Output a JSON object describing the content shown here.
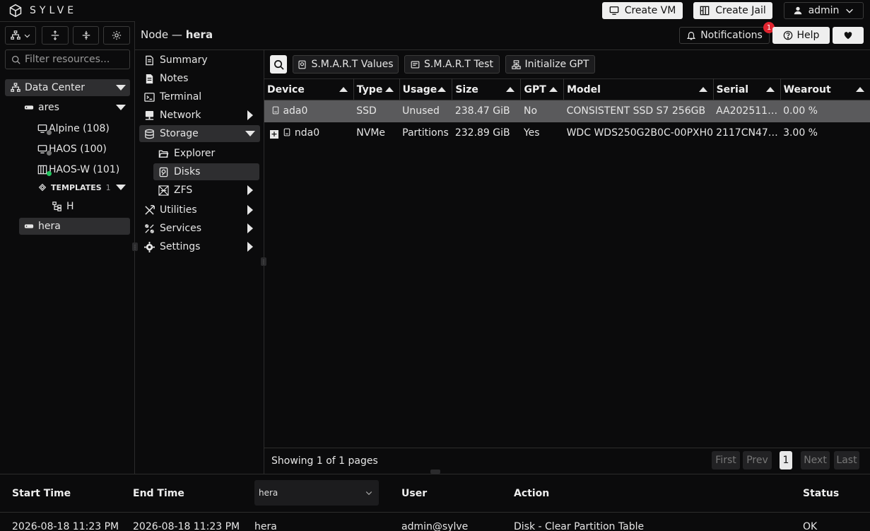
{
  "app": {
    "brand": "SYLVE"
  },
  "topbar": {
    "create_vm": "Create VM",
    "create_jail": "Create Jail",
    "user": "admin"
  },
  "sidebar": {
    "filter_placeholder": "Filter resources...",
    "tree": {
      "datacenter": "Data Center",
      "node_ares": "ares",
      "vm_alpine": "Alpine (108)",
      "vm_haos": "HAOS (100)",
      "jail_haosw": "HAOS-W (101)",
      "templates": "TEMPLATES",
      "templates_count": "1",
      "template_h": "H",
      "node_hera": "hera"
    },
    "status_colors": {
      "stopped": "#777777",
      "running": "#22c55e"
    }
  },
  "header": {
    "prefix": "Node —",
    "node": "hera",
    "notifications": "Notifications",
    "notif_count": "1",
    "help": "Help"
  },
  "nav": {
    "summary": "Summary",
    "notes": "Notes",
    "terminal": "Terminal",
    "network": "Network",
    "storage": "Storage",
    "explorer": "Explorer",
    "disks": "Disks",
    "zfs": "ZFS",
    "utilities": "Utilities",
    "services": "Services",
    "settings": "Settings"
  },
  "toolbar": {
    "smart_values": "S.M.A.R.T Values",
    "smart_test": "S.M.A.R.T Test",
    "init_gpt": "Initialize GPT"
  },
  "table": {
    "columns": [
      "Device",
      "Type",
      "Usage",
      "Size",
      "GPT",
      "Model",
      "Serial",
      "Wearout"
    ],
    "rows": [
      {
        "device": "ada0",
        "type": "SSD",
        "usage": "Unused",
        "size": "238.47 GiB",
        "gpt": "No",
        "model": "CONSISTENT SSD S7 256GB",
        "serial": "AA20251111…",
        "wearout": "0.00 %"
      },
      {
        "device": "nda0",
        "type": "NVMe",
        "usage": "Partitions",
        "size": "232.89 GiB",
        "gpt": "Yes",
        "model": "WDC WDS250G2B0C-00PXH0",
        "serial": "2117CN474…",
        "wearout": "3.00 %"
      }
    ]
  },
  "pager": {
    "text": "Showing 1 of 1 pages",
    "first": "First",
    "prev": "Prev",
    "current": "1",
    "next": "Next",
    "last": "Last"
  },
  "audit": {
    "headers": {
      "start": "Start Time",
      "end": "End Time",
      "user": "User",
      "action": "Action",
      "status": "Status"
    },
    "node_filter": "hera",
    "row": {
      "start": "2026-08-18 11:23 PM",
      "end": "2026-08-18 11:23 PM",
      "node": "hera",
      "user": "admin@sylve",
      "action": "Disk - Clear Partition Table",
      "status": "OK"
    }
  }
}
